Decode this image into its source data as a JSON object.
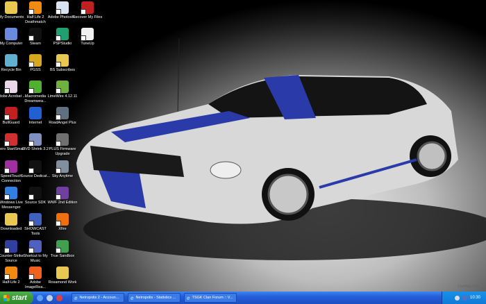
{
  "desktop": {
    "icons": [
      {
        "label": "My Documents",
        "icon": "folder-documents-icon",
        "color": "#e8c850",
        "shortcut": false
      },
      {
        "label": "Half Life 2 Deathmatch",
        "icon": "half-life-icon",
        "color": "#f08a10",
        "shortcut": true
      },
      {
        "label": "Adobe Photosh...",
        "icon": "photoshop-icon",
        "color": "#d8e4f0",
        "shortcut": true
      },
      {
        "label": "Recover My Files",
        "icon": "recover-files-icon",
        "color": "#c02020",
        "shortcut": true
      },
      {
        "label": "My Computer",
        "icon": "computer-icon",
        "color": "#6a8ae0",
        "shortcut": false
      },
      {
        "label": "Steam",
        "icon": "steam-icon",
        "color": "#111111",
        "shortcut": true
      },
      {
        "label": "PSPStudio",
        "icon": "psp-icon",
        "color": "#20a070",
        "shortcut": true
      },
      {
        "label": "TuneUp",
        "icon": "tuneup-icon",
        "color": "#f0f0f0",
        "shortcut": true
      },
      {
        "label": "Recycle Bin",
        "icon": "recycle-bin-icon",
        "color": "#60b0d0",
        "shortcut": false
      },
      {
        "label": "PGSS",
        "icon": "lock-icon",
        "color": "#d8a820",
        "shortcut": true
      },
      {
        "label": "BS Subscribes",
        "icon": "folder-icon",
        "color": "#e8c850",
        "shortcut": true
      },
      {
        "label": "Adobe Acrobat ...",
        "icon": "acrobat-icon",
        "color": "#e8d8e8",
        "shortcut": true
      },
      {
        "label": "Macromedia Dreamwea...",
        "icon": "dreamweaver-icon",
        "color": "#50b030",
        "shortcut": true
      },
      {
        "label": "LimeWire 4.12.11",
        "icon": "limewire-icon",
        "color": "#70b040",
        "shortcut": true
      },
      {
        "label": "BullGuard",
        "icon": "bullguard-icon",
        "color": "#c02020",
        "shortcut": true
      },
      {
        "label": "Internet",
        "icon": "internet-explorer-icon",
        "color": "#2060d0",
        "shortcut": false
      },
      {
        "label": "RoadAngel Plus",
        "icon": "roadangel-icon",
        "color": "#607080",
        "shortcut": true
      },
      {
        "label": "Nero StartSmart",
        "icon": "nero-icon",
        "color": "#d03030",
        "shortcut": true
      },
      {
        "label": "DVD Shrink 3.2",
        "icon": "dvd-shrink-icon",
        "color": "#8090c0",
        "shortcut": true
      },
      {
        "label": "PLUS Firmware Upgrade",
        "icon": "firmware-icon",
        "color": "#707070",
        "shortcut": true
      },
      {
        "label": "SpeedTouch Connection",
        "icon": "speedtouch-icon",
        "color": "#a030a0",
        "shortcut": true
      },
      {
        "label": "Source Dedicat...",
        "icon": "steam-icon",
        "color": "#111111",
        "shortcut": true
      },
      {
        "label": "Sky Anytime",
        "icon": "sky-icon",
        "color": "#8090a0",
        "shortcut": true
      },
      {
        "label": "Windows Live Messenger",
        "icon": "messenger-icon",
        "color": "#3080e0",
        "shortcut": true
      },
      {
        "label": "Source SDK",
        "icon": "steam-icon",
        "color": "#111111",
        "shortcut": true
      },
      {
        "label": "WWF 2nd Edition",
        "icon": "game-icon",
        "color": "#7040a0",
        "shortcut": true
      },
      {
        "label": "Downloaded",
        "icon": "folder-icon",
        "color": "#e8c850",
        "shortcut": false
      },
      {
        "label": "SHOWCAST Tools",
        "icon": "tools-icon",
        "color": "#4060c0",
        "shortcut": true
      },
      {
        "label": "Xfire",
        "icon": "xfire-icon",
        "color": "#f07010",
        "shortcut": true
      },
      {
        "label": "Counter-Strike Source",
        "icon": "counter-strike-icon",
        "color": "#3040a0",
        "shortcut": true
      },
      {
        "label": "Shortcut to My Music",
        "icon": "music-icon",
        "color": "#5060c0",
        "shortcut": true
      },
      {
        "label": "True Sandbox",
        "icon": "cube-icon",
        "color": "#40a050",
        "shortcut": true
      },
      {
        "label": "Half-Life 2",
        "icon": "half-life-icon",
        "color": "#f08a10",
        "shortcut": true
      },
      {
        "label": "Adobe ImageRea...",
        "icon": "imageready-icon",
        "color": "#f06020",
        "shortcut": true
      },
      {
        "label": "Rosamond Work",
        "icon": "folder-icon",
        "color": "#e8c850",
        "shortcut": false
      }
    ]
  },
  "wallpaper": {
    "watermark": "CarWalls.com"
  },
  "taskbar": {
    "start_label": "start",
    "quick_launch": [
      {
        "icon": "internet-explorer-icon",
        "color": "#5aa0f0"
      },
      {
        "icon": "show-desktop-icon",
        "color": "#c0d0e0"
      },
      {
        "icon": "media-player-icon",
        "color": "#e04040"
      }
    ],
    "tasks": [
      {
        "label": "Netropolis 2 - Accoun..."
      },
      {
        "label": "Netropolis - Statistics ..."
      },
      {
        "label": "TSGK Clan Forum :: V..."
      }
    ],
    "clock": "10:30"
  }
}
